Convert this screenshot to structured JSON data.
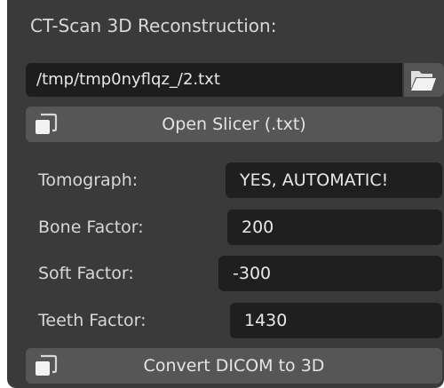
{
  "panel": {
    "title": "CT-Scan 3D Reconstruction:",
    "file_path": "/tmp/tmp0nyflqz_/2.txt",
    "open_button_label": "Open Slicer (.txt)",
    "fields": [
      {
        "label": "Tomograph:",
        "value": "YES, AUTOMATIC!"
      },
      {
        "label": "Bone Factor:",
        "value": "200"
      },
      {
        "label": "Soft Factor:",
        "value": "-300"
      },
      {
        "label": "Teeth Factor:",
        "value": "1430"
      }
    ],
    "convert_button_label": "Convert DICOM to 3D"
  },
  "icons": {
    "file_browser": "folder-open-icon",
    "open_button": "window-copy-icon",
    "convert_button": "window-copy-icon"
  }
}
